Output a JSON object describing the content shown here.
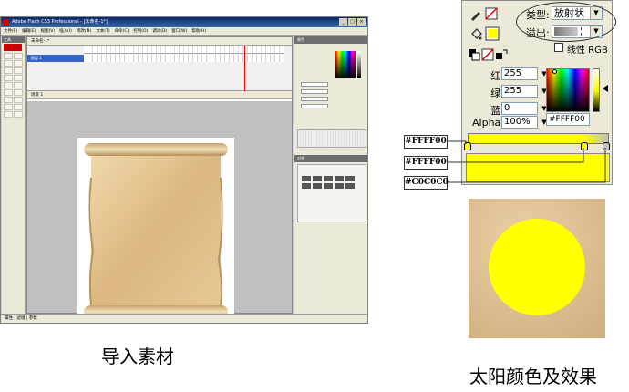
{
  "flash": {
    "title": "Adobe Flash CS3 Professional - [未命名-1*]",
    "menu": [
      "文件(F)",
      "编辑(E)",
      "视图(V)",
      "插入(I)",
      "修改(M)",
      "文本(T)",
      "命令(C)",
      "控制(O)",
      "调试(D)",
      "窗口(W)",
      "帮助(H)"
    ],
    "doc_tab": "未命名-1*",
    "layer_name": "图层 1",
    "scene": "场景 1",
    "timeline_status": "100    12.0 fps    8.3s",
    "tools_header": "工具",
    "props_header": "颜色",
    "align_header": "对齐",
    "status_tabs": "属性 | 滤镜 | 参数",
    "zoom": "100%"
  },
  "mixer": {
    "type_label": "类型:",
    "type_value": "放射状",
    "overflow_label": "溢出:",
    "linear_rgb_label": "线性 RGB",
    "red_label": "红:",
    "red_value": "255",
    "green_label": "绿:",
    "green_value": "255",
    "blue_label": "蓝:",
    "blue_value": "0",
    "alpha_label": "Alpha:",
    "alpha_value": "100%",
    "hex_value": "#FFFF00",
    "fill_color": "#ffff00",
    "outer_color": "#c0c0c0"
  },
  "callouts": {
    "stop1": "#FFFF00",
    "stop2": "#FFFF00",
    "stop3": "#C0C0C0"
  },
  "captions": {
    "left": "导入素材",
    "right": "太阳颜色及效果"
  }
}
